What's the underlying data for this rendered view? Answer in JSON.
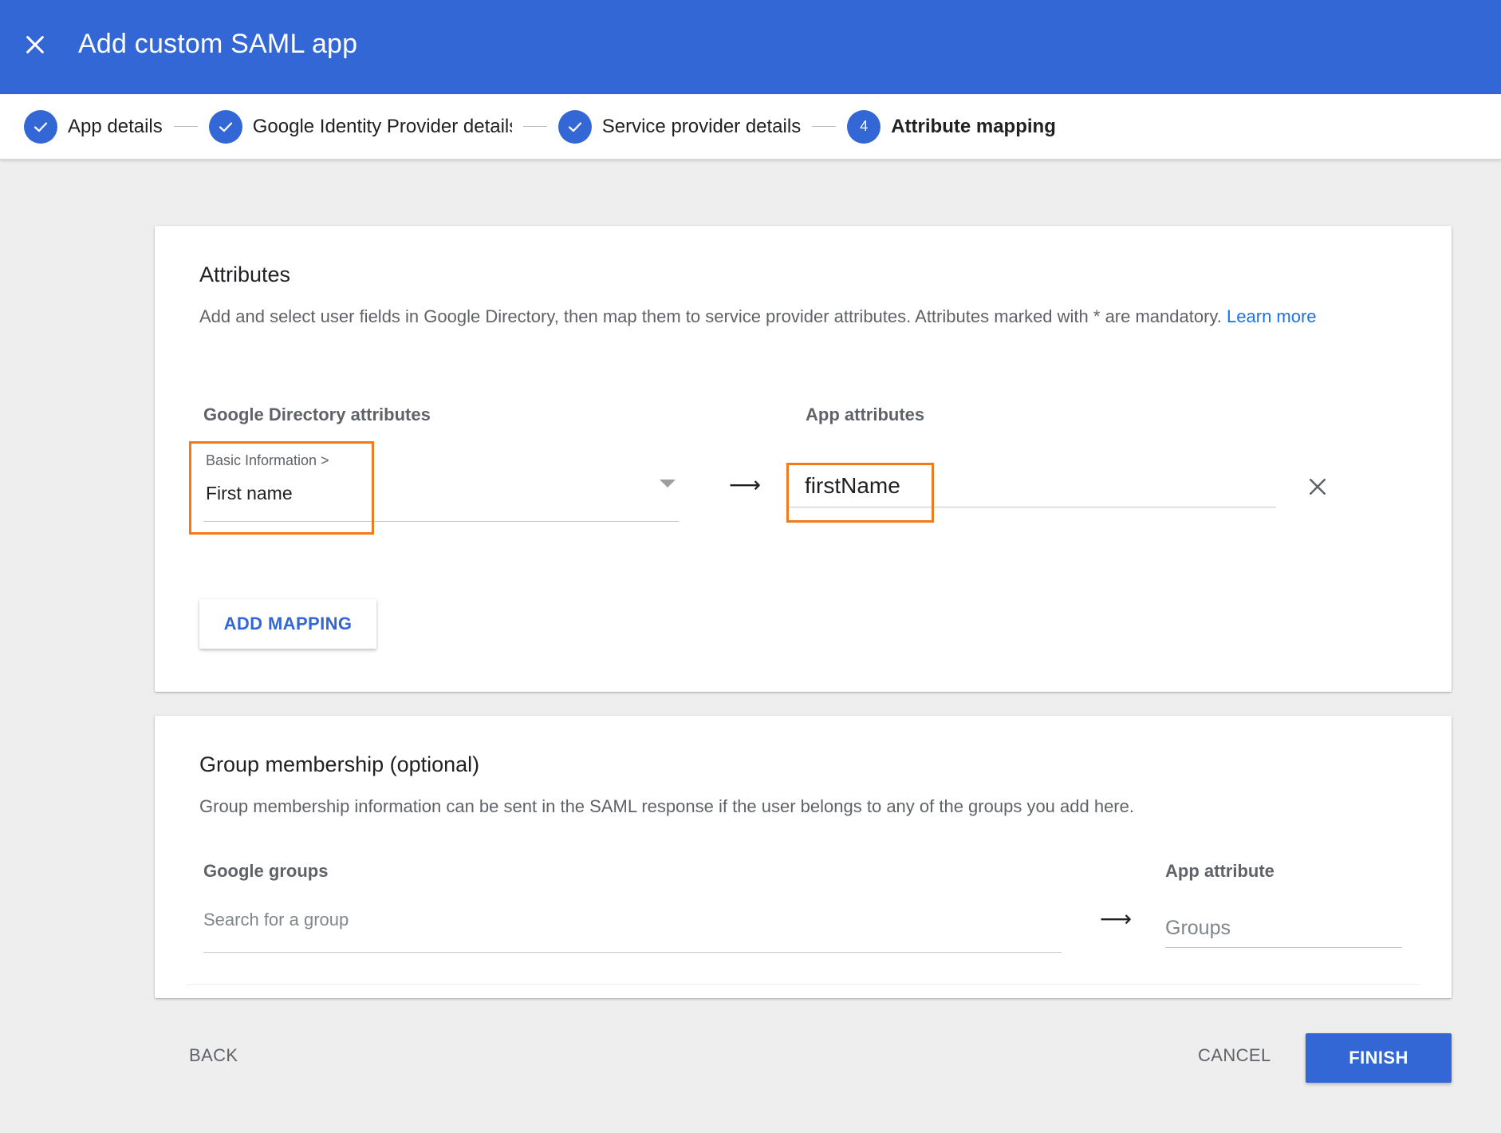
{
  "header": {
    "title": "Add custom SAML app",
    "close_icon": "close-icon"
  },
  "stepper": {
    "steps": [
      {
        "label": "App details",
        "state": "done"
      },
      {
        "label": "Google Identity Provider details",
        "state": "done"
      },
      {
        "label": "Service provider details",
        "state": "done"
      },
      {
        "label": "Attribute mapping",
        "state": "active",
        "number": "4"
      }
    ]
  },
  "attributes": {
    "title": "Attributes",
    "description": "Add and select user fields in Google Directory, then map them to service provider attributes. Attributes marked with * are mandatory.",
    "learn_more": "Learn more",
    "col_directory": "Google Directory attributes",
    "col_app": "App attributes",
    "mapping": {
      "category": "Basic Information >",
      "directory_value": "First name",
      "app_value": "firstName"
    },
    "add_mapping_label": "ADD MAPPING"
  },
  "groups": {
    "title": "Group membership (optional)",
    "description": "Group membership information can be sent in the SAML response if the user belongs to any of the groups you add here.",
    "col_groups": "Google groups",
    "col_app": "App attribute",
    "search_placeholder": "Search for a group",
    "app_placeholder": "Groups"
  },
  "footer": {
    "back_label": "BACK",
    "cancel_label": "CANCEL",
    "finish_label": "FINISH"
  },
  "colors": {
    "primary": "#3367d6",
    "highlight": "#f07a1c",
    "link": "#1a73e8"
  }
}
